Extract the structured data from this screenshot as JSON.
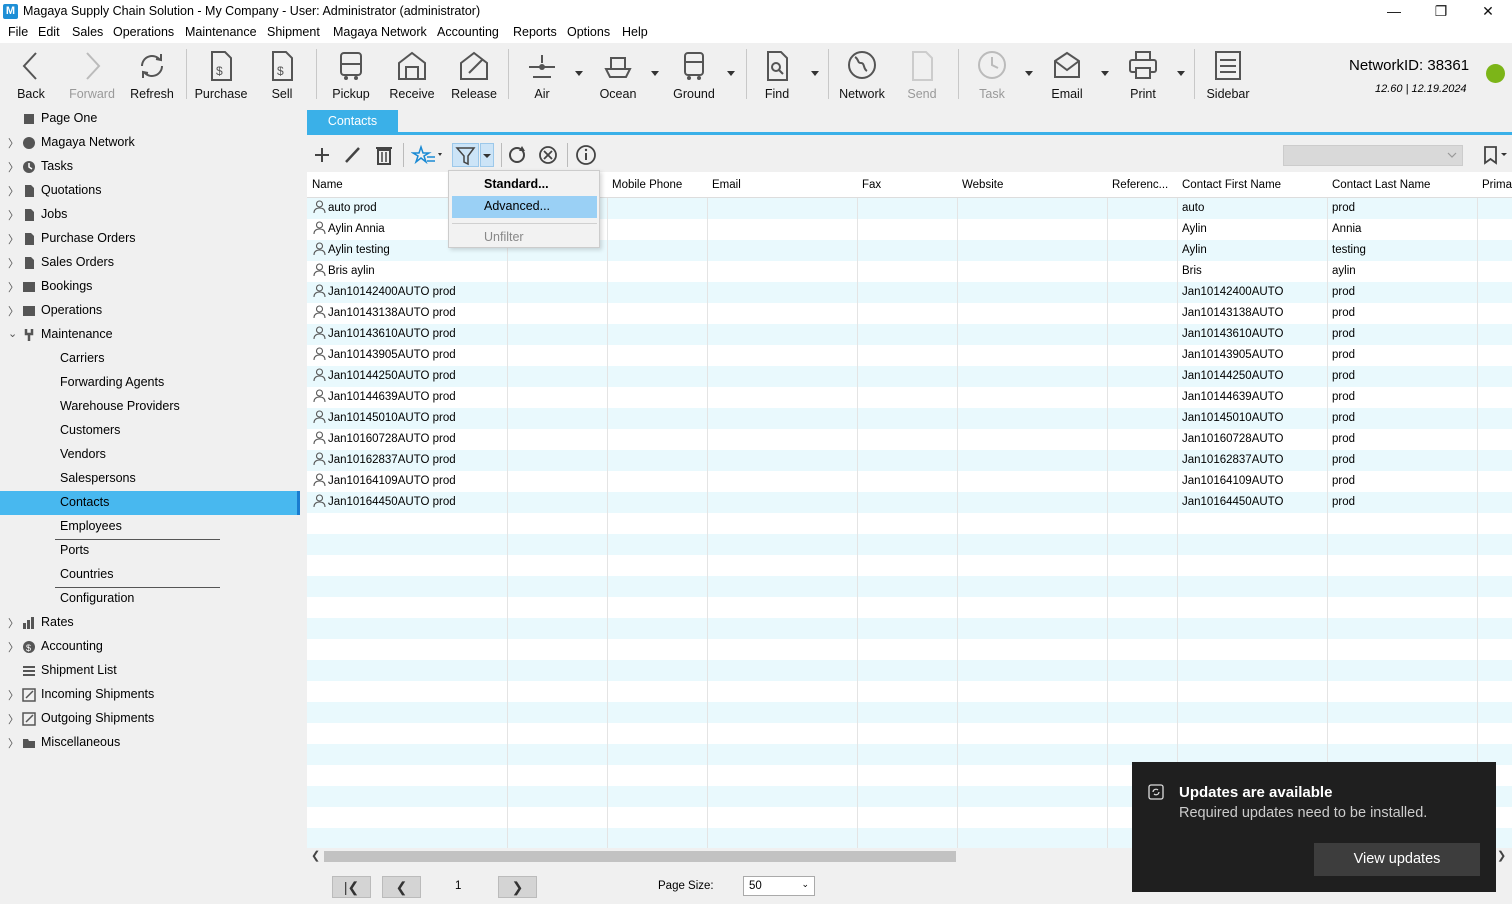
{
  "window": {
    "title": "Magaya Supply Chain Solution - My Company - User: Administrator (administrator)",
    "app_icon_letter": "M"
  },
  "menubar": [
    "File",
    "Edit",
    "Sales",
    "Operations",
    "Maintenance",
    "Shipment",
    "Magaya Network",
    "Accounting",
    "Reports",
    "Options",
    "Help"
  ],
  "toolbar": {
    "back": "Back",
    "forward": "Forward",
    "refresh": "Refresh",
    "purchase": "Purchase",
    "sell": "Sell",
    "pickup": "Pickup",
    "receive": "Receive",
    "release": "Release",
    "air": "Air",
    "ocean": "Ocean",
    "ground": "Ground",
    "find": "Find",
    "network": "Network",
    "send": "Send",
    "task": "Task",
    "email": "Email",
    "print": "Print",
    "sidebar": "Sidebar"
  },
  "network": {
    "id": "NetworkID: 38361",
    "version": "12.60 | 12.19.2024",
    "status_color": "#7cb518"
  },
  "sidebar": {
    "page_one": "Page One",
    "magaya_network": "Magaya Network",
    "tasks": "Tasks",
    "quotations": "Quotations",
    "jobs": "Jobs",
    "purchase_orders": "Purchase Orders",
    "sales_orders": "Sales Orders",
    "bookings": "Bookings",
    "operations": "Operations",
    "maintenance": "Maintenance",
    "maint_items": [
      "Carriers",
      "Forwarding Agents",
      "Warehouse Providers",
      "Customers",
      "Vendors",
      "Salespersons",
      "Contacts",
      "Employees",
      "Ports",
      "Countries",
      "Configuration"
    ],
    "rates": "Rates",
    "accounting": "Accounting",
    "shipment_list": "Shipment List",
    "incoming": "Incoming Shipments",
    "outgoing": "Outgoing Shipments",
    "misc": "Miscellaneous"
  },
  "tabs": {
    "active": "Contacts"
  },
  "filter_menu": {
    "standard": "Standard...",
    "advanced": "Advanced...",
    "unfilter": "Unfilter"
  },
  "grid": {
    "columns": [
      "Name",
      "Mobile Phone",
      "Email",
      "Fax",
      "Website",
      "Referenc...",
      "Contact First Name",
      "Contact Last Name",
      "Primar"
    ],
    "rows": [
      [
        "auto prod",
        "auto",
        "prod"
      ],
      [
        "Aylin Annia",
        "Aylin",
        "Annia"
      ],
      [
        "Aylin testing",
        "Aylin",
        "testing"
      ],
      [
        "Bris aylin",
        "Bris",
        "aylin"
      ],
      [
        "Jan10142400AUTO prod",
        "Jan10142400AUTO",
        "prod"
      ],
      [
        "Jan10143138AUTO prod",
        "Jan10143138AUTO",
        "prod"
      ],
      [
        "Jan10143610AUTO prod",
        "Jan10143610AUTO",
        "prod"
      ],
      [
        "Jan10143905AUTO prod",
        "Jan10143905AUTO",
        "prod"
      ],
      [
        "Jan10144250AUTO prod",
        "Jan10144250AUTO",
        "prod"
      ],
      [
        "Jan10144639AUTO prod",
        "Jan10144639AUTO",
        "prod"
      ],
      [
        "Jan10145010AUTO prod",
        "Jan10145010AUTO",
        "prod"
      ],
      [
        "Jan10160728AUTO prod",
        "Jan10160728AUTO",
        "prod"
      ],
      [
        "Jan10162837AUTO prod",
        "Jan10162837AUTO",
        "prod"
      ],
      [
        "Jan10164109AUTO prod",
        "Jan10164109AUTO",
        "prod"
      ],
      [
        "Jan10164450AUTO prod",
        "Jan10164450AUTO",
        "prod"
      ]
    ]
  },
  "pager": {
    "page": "1",
    "page_size_label": "Page Size:",
    "page_size": "50"
  },
  "toast": {
    "title": "Updates are available",
    "message": "Required updates need to be installed.",
    "button": "View updates"
  }
}
